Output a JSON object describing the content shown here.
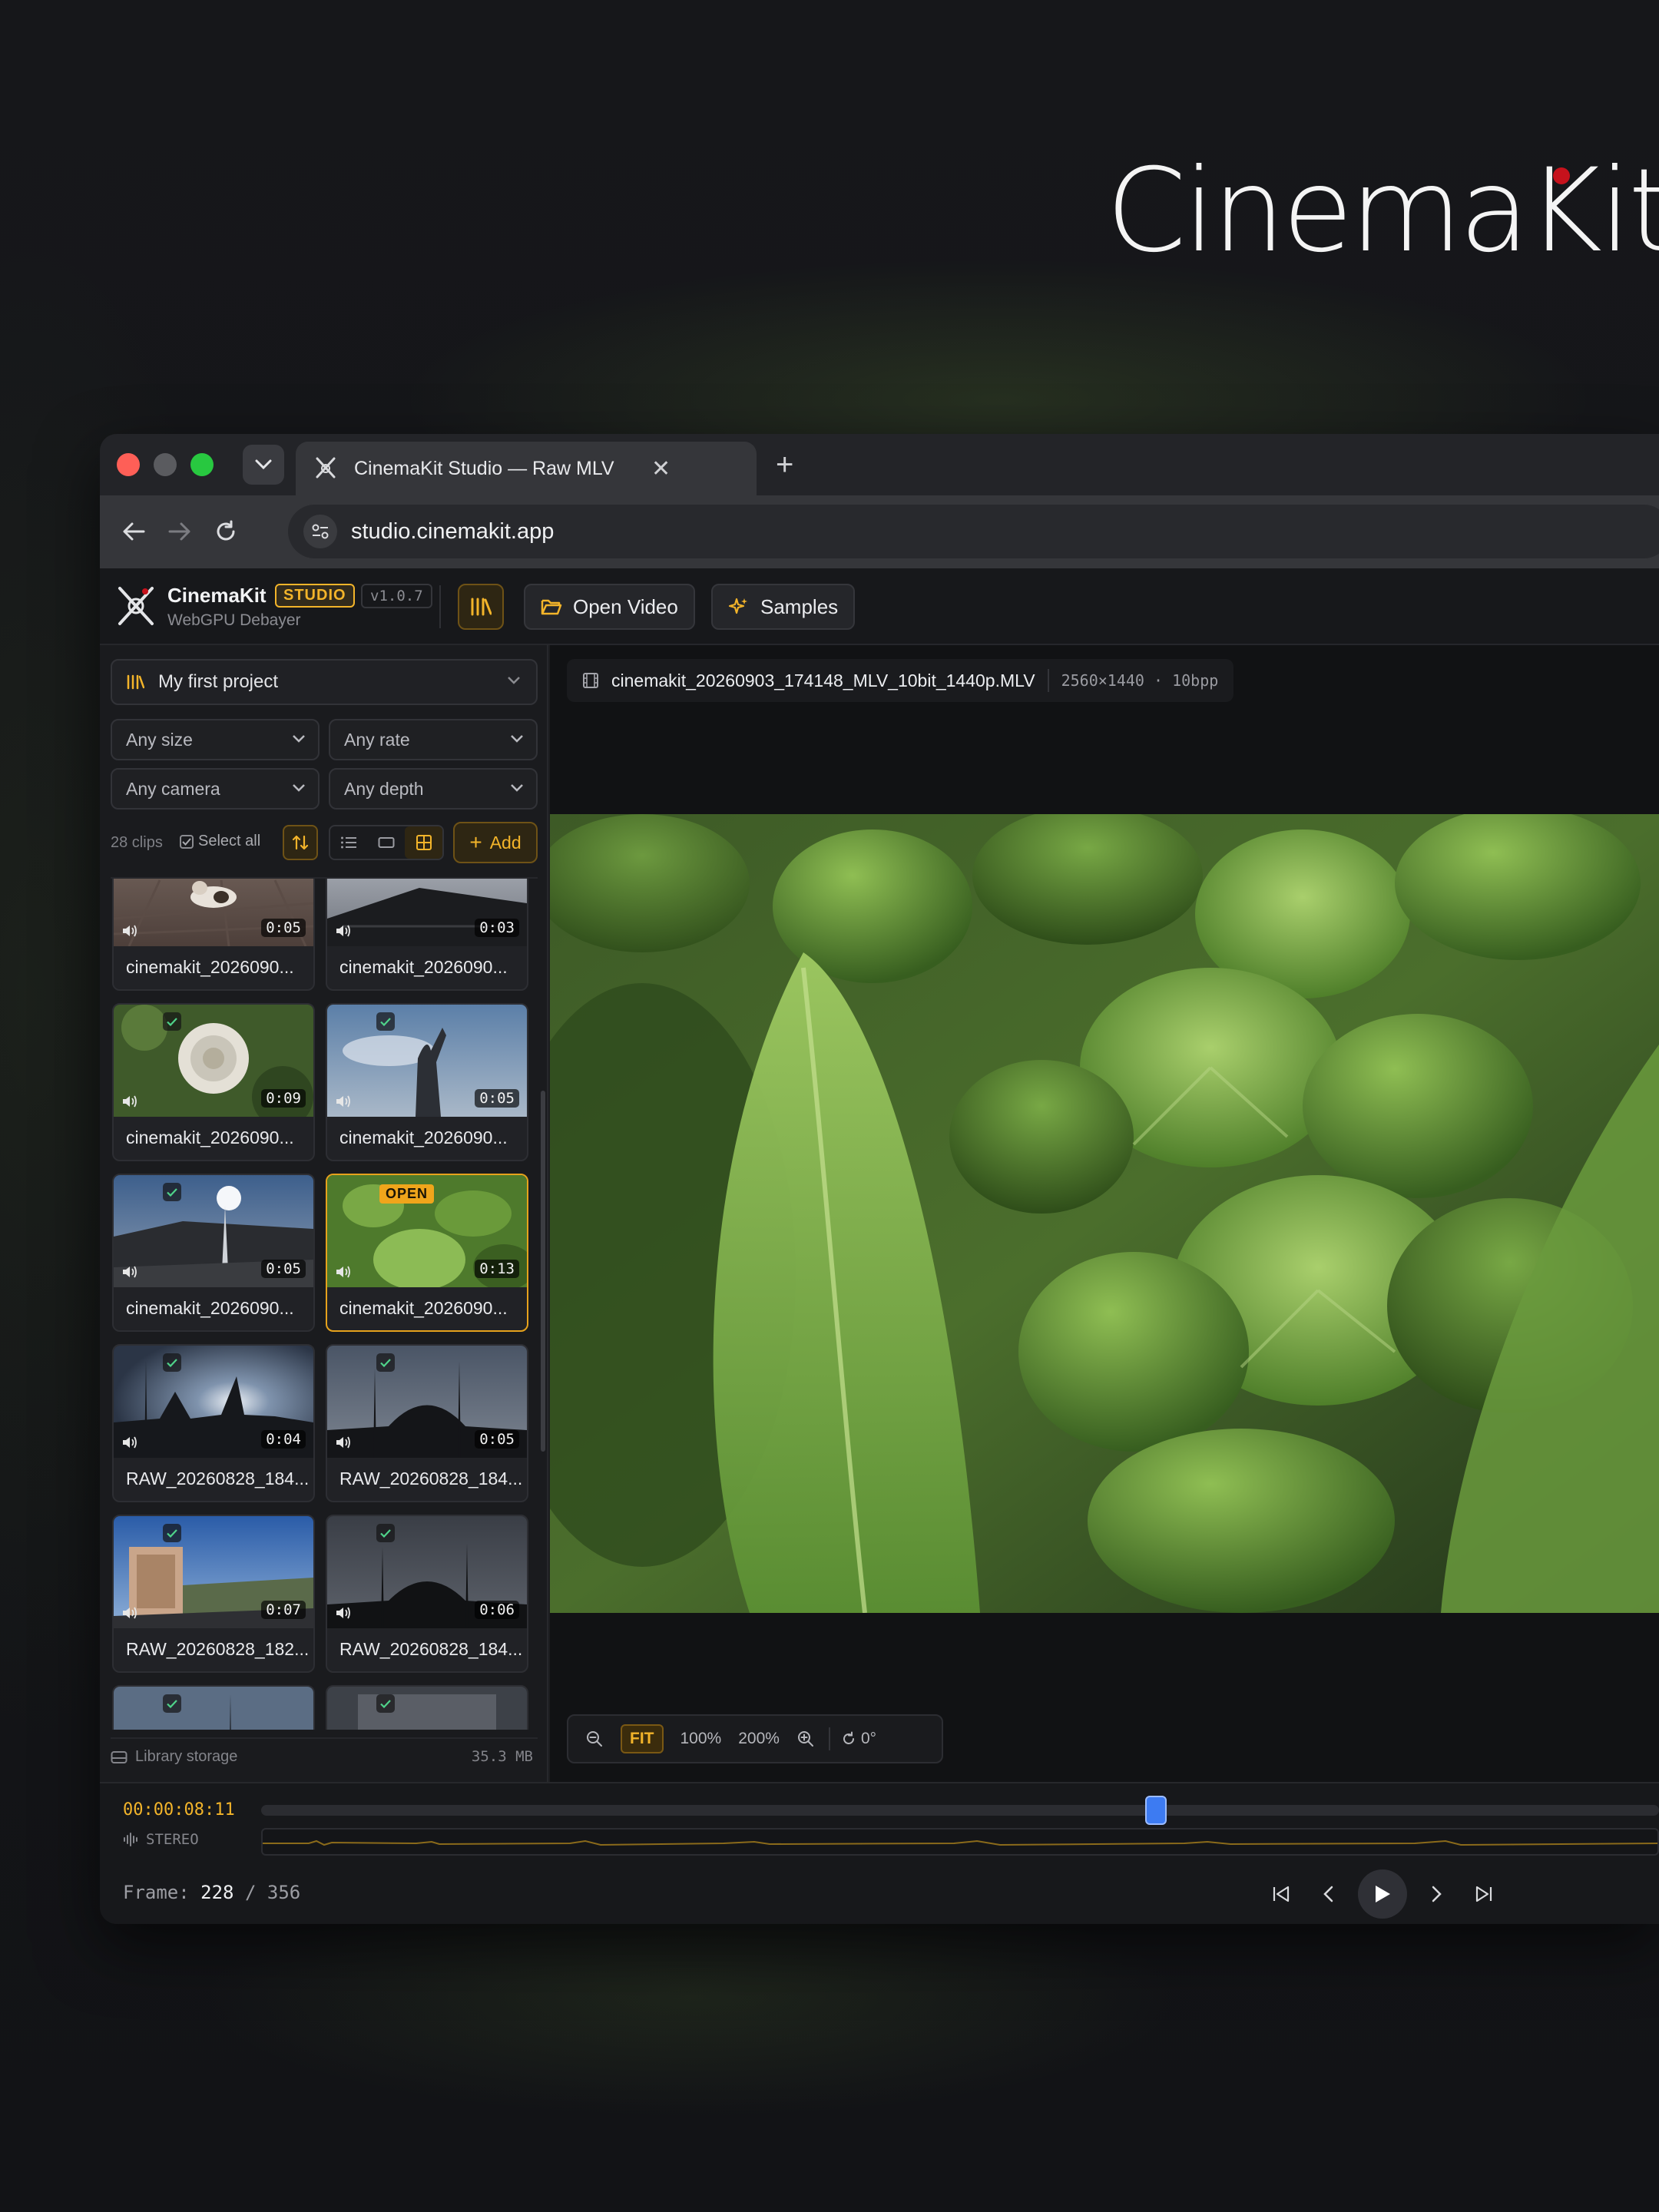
{
  "brand": {
    "wordmark": "CinemaKit",
    "dot_color": "#c6121c"
  },
  "browser": {
    "tab_title": "CinemaKit Studio — Raw MLV",
    "url": "studio.cinemakit.app"
  },
  "app": {
    "name": "CinemaKit",
    "badge": "STUDIO",
    "version": "v1.0.7",
    "subtitle": "WebGPU Debayer",
    "open_video_label": "Open Video",
    "samples_label": "Samples",
    "accent": "#f3b42a"
  },
  "sidebar": {
    "project": "My first project",
    "filters": {
      "size": "Any size",
      "rate": "Any rate",
      "camera": "Any camera",
      "depth": "Any depth"
    },
    "clips_count": "28 clips",
    "select_all": "Select all",
    "add_label": "Add",
    "clips": [
      {
        "name": "cinemakit_2026090...",
        "duration": "0:05",
        "checked": false,
        "open": false
      },
      {
        "name": "cinemakit_2026090...",
        "duration": "0:03",
        "checked": false,
        "open": false
      },
      {
        "name": "cinemakit_2026090...",
        "duration": "0:09",
        "checked": true,
        "open": false
      },
      {
        "name": "cinemakit_2026090...",
        "duration": "0:05",
        "checked": true,
        "open": false
      },
      {
        "name": "cinemakit_2026090...",
        "duration": "0:05",
        "checked": true,
        "open": false
      },
      {
        "name": "cinemakit_2026090...",
        "duration": "0:13",
        "checked": false,
        "open": true,
        "badge": "OPEN"
      },
      {
        "name": "RAW_20260828_184...",
        "duration": "0:04",
        "checked": true,
        "open": false
      },
      {
        "name": "RAW_20260828_184...",
        "duration": "0:05",
        "checked": true,
        "open": false
      },
      {
        "name": "RAW_20260828_182...",
        "duration": "0:07",
        "checked": true,
        "open": false
      },
      {
        "name": "RAW_20260828_184...",
        "duration": "0:06",
        "checked": true,
        "open": false
      }
    ],
    "storage_label": "Library storage",
    "storage_value": "35.3 MB"
  },
  "viewer": {
    "file_name": "cinemakit_20260903_174148_MLV_10bit_1440p.MLV",
    "file_meta": "2560×1440 · 10bpp",
    "zoom": {
      "fit": "FIT",
      "z100": "100%",
      "z200": "200%",
      "rotation": "0°"
    }
  },
  "timeline": {
    "timecode": "00:00:08:11",
    "audio_label": "STEREO",
    "frame_label": "Frame:",
    "frame_current": "228",
    "frame_sep": "/",
    "frame_total": "356",
    "progress": 0.64
  }
}
